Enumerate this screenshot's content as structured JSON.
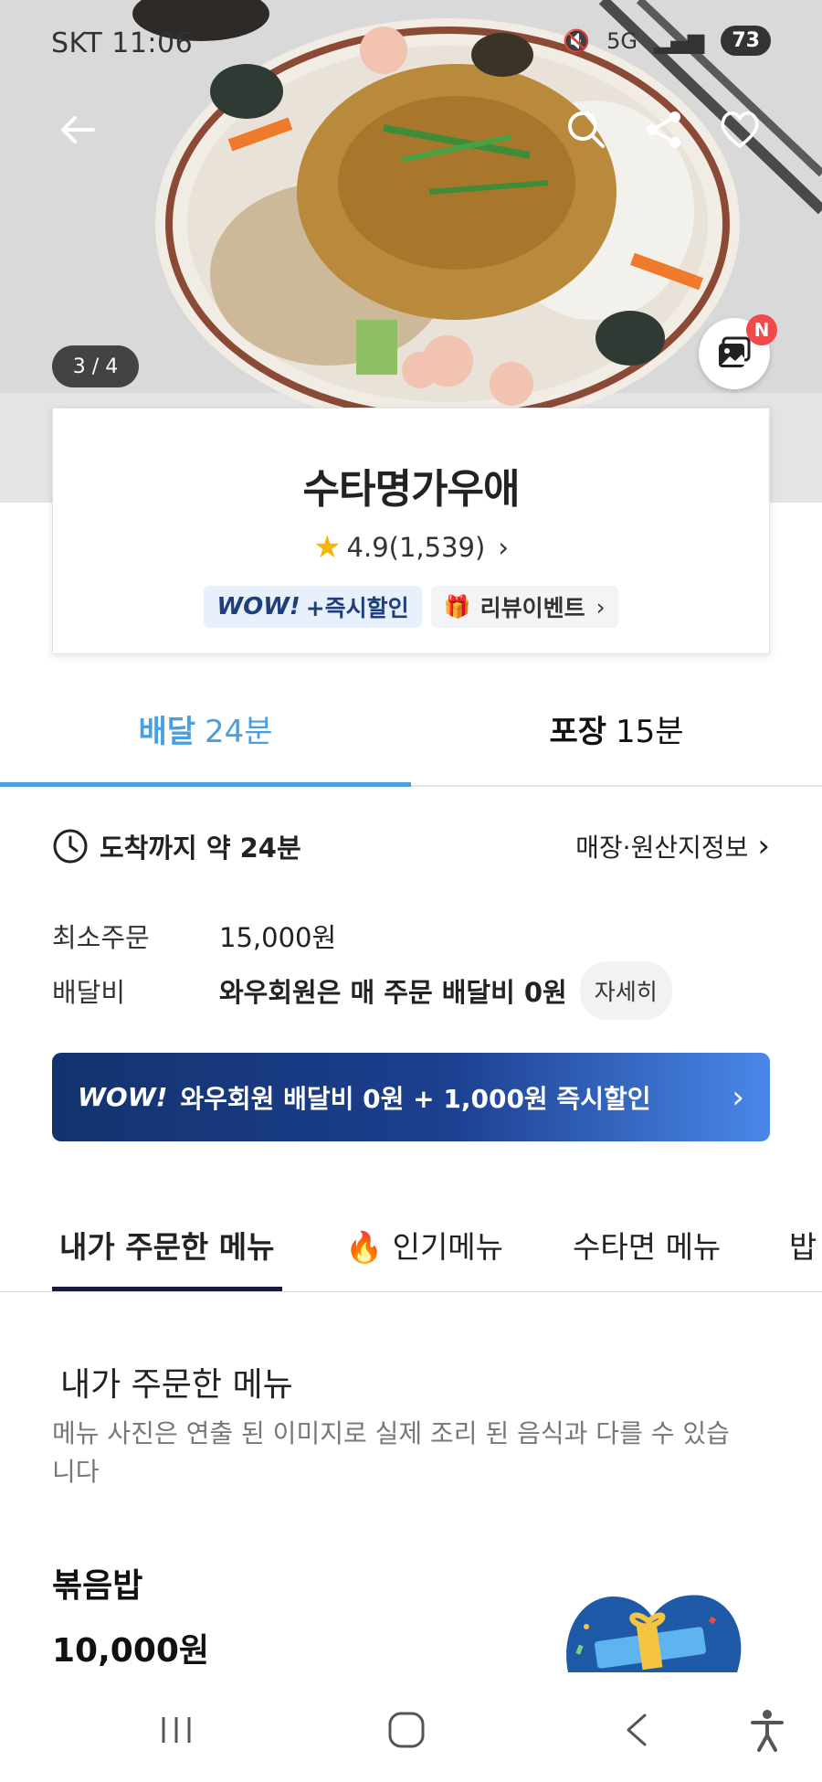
{
  "status_bar": {
    "time": "SKT 11:06",
    "battery": "73",
    "network": "5G"
  },
  "hero": {
    "page_indicator": "3 / 4",
    "photo_review_badge": "N",
    "icons": [
      "back-arrow-icon",
      "search-icon",
      "share-icon",
      "heart-icon",
      "photo-review-icon"
    ]
  },
  "store": {
    "name": "수타명가우애",
    "rating": "4.9(1,539)",
    "wow_chip_logo": "WOW!",
    "wow_chip_text": "+즉시할인",
    "review_event": "리뷰이벤트"
  },
  "delivery_tabs": [
    {
      "label": "배달",
      "time": "24분",
      "active": true
    },
    {
      "label": "포장",
      "time": "15분",
      "active": false
    }
  ],
  "info": {
    "arrival": "도착까지 약 24분",
    "origin_link": "매장·원산지정보",
    "min_order_label": "최소주문",
    "min_order_value": "15,000원",
    "delivery_fee_label": "배달비",
    "delivery_fee_value": "와우회원은 매 주문 배달비 0원",
    "detail_button": "자세히"
  },
  "wow_banner": {
    "logo": "WOW!",
    "text": "와우회원 배달비 0원 + 1,000원 즉시할인"
  },
  "menu_tabs": [
    {
      "label": "내가 주문한 메뉴",
      "active": true
    },
    {
      "label": "🔥 인기메뉴",
      "active": false
    },
    {
      "label": "수타면 메뉴",
      "active": false
    },
    {
      "label": "밥",
      "active": false
    }
  ],
  "menu_section": {
    "title": "내가 주문한 메뉴",
    "description": "메뉴 사진은 연출 된 이미지로 실제 조리 된 음식과 다를 수 있습니다"
  },
  "menu_item": {
    "name": "볶음밥",
    "price": "10,000원"
  },
  "colors": {
    "accent_blue": "#4a9fe2",
    "wow_navy": "#13336e",
    "badge_red": "#ef4b4b",
    "star_yellow": "#f5b800"
  }
}
